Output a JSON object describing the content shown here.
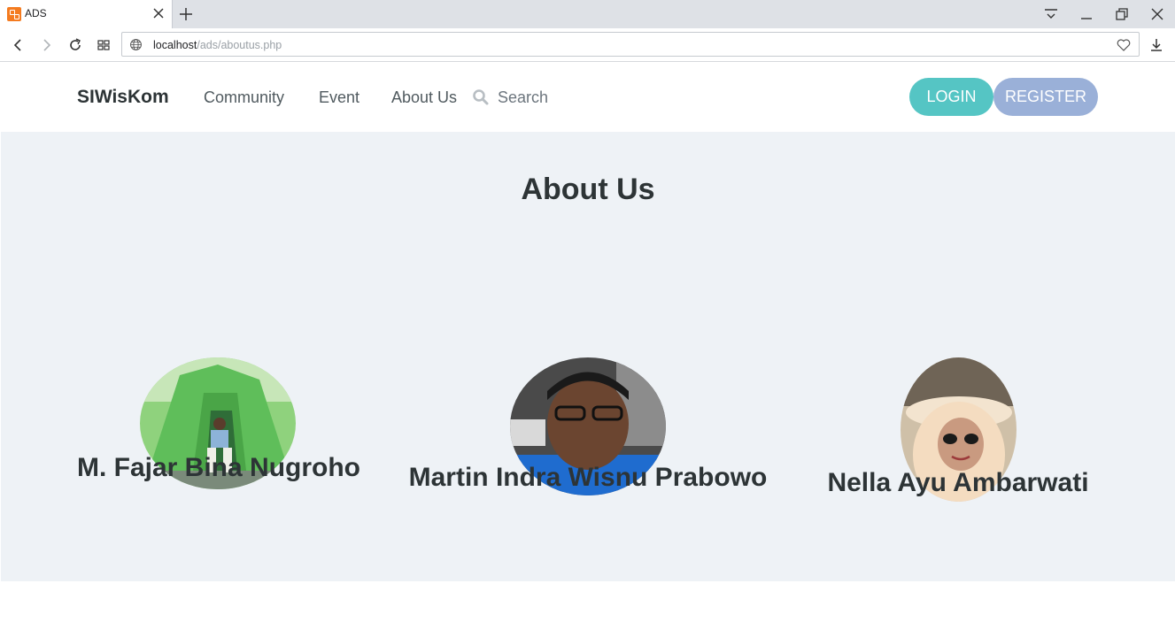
{
  "browser": {
    "tab_title": "ADS",
    "address": {
      "host": "localhost",
      "path": "/ads/aboutus.php"
    }
  },
  "navbar": {
    "brand": "SIWisKom",
    "links": [
      "Community",
      "Event",
      "About Us"
    ],
    "search_placeholder": "Search",
    "login_label": "LOGIN",
    "register_label": "REGISTER"
  },
  "about": {
    "title": "About Us",
    "members": [
      {
        "name": "M. Fajar Bina Nugroho"
      },
      {
        "name": "Martin Indra Wisnu Prabowo"
      },
      {
        "name": "Nella Ayu Ambarwati"
      }
    ]
  },
  "colors": {
    "login_button": "#55c5c4",
    "register_button": "#9ab0d8",
    "section_background": "#eef2f6",
    "heading_text": "#2d3436"
  }
}
